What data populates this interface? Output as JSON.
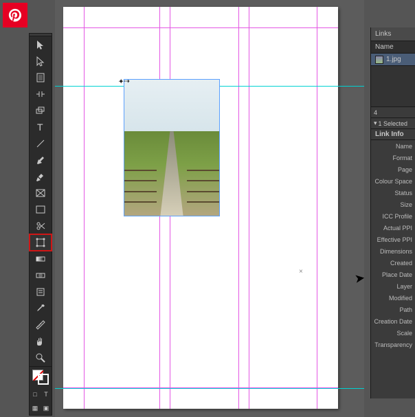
{
  "pinterest": {
    "name": "pinterest"
  },
  "tools": [
    {
      "name": "selection-tool",
      "icon": "arrow"
    },
    {
      "name": "direct-selection-tool",
      "icon": "arrow-open"
    },
    {
      "name": "page-tool",
      "icon": "page"
    },
    {
      "name": "gap-tool",
      "icon": "gap"
    },
    {
      "name": "content-collector-tool",
      "icon": "collector"
    },
    {
      "name": "type-tool",
      "icon": "type"
    },
    {
      "name": "line-tool",
      "icon": "line"
    },
    {
      "name": "pen-tool",
      "icon": "pen"
    },
    {
      "name": "pencil-tool",
      "icon": "pencil"
    },
    {
      "name": "rectangle-frame-tool",
      "icon": "rectframe"
    },
    {
      "name": "rectangle-tool",
      "icon": "rect"
    },
    {
      "name": "scissors-tool",
      "icon": "scissors"
    },
    {
      "name": "free-transform-tool",
      "icon": "transform",
      "highlighted": true
    },
    {
      "name": "gradient-swatch-tool",
      "icon": "gradient"
    },
    {
      "name": "gradient-feather-tool",
      "icon": "feather"
    },
    {
      "name": "note-tool",
      "icon": "note"
    },
    {
      "name": "eyedropper-tool",
      "icon": "eyedrop"
    },
    {
      "name": "measure-tool",
      "icon": "measure"
    },
    {
      "name": "hand-tool",
      "icon": "hand"
    },
    {
      "name": "zoom-tool",
      "icon": "zoom"
    }
  ],
  "linksPanel": {
    "tab": "Links",
    "nameHeader": "Name",
    "file": "1.jpg",
    "count": "4",
    "selected": "1 Selected",
    "infoHeader": "Link Info",
    "fields": [
      "Name",
      "Format",
      "Page",
      "Colour Space",
      "Status",
      "Size",
      "ICC Profile",
      "Actual PPI",
      "Effective PPI",
      "Dimensions",
      "Created",
      "Place Date",
      "Layer",
      "Modified",
      "Path",
      "Creation Date",
      "Scale",
      "Transparency"
    ]
  }
}
